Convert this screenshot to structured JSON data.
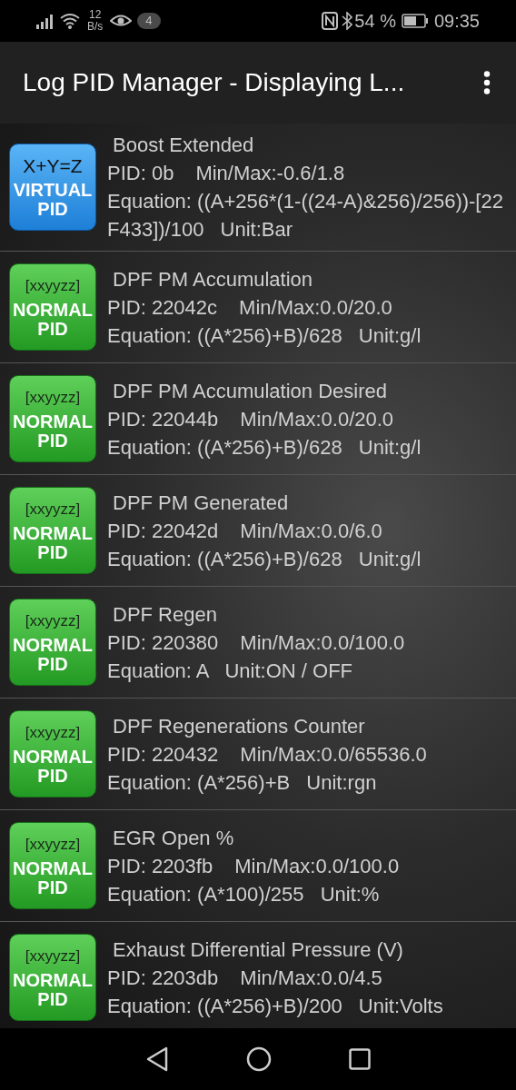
{
  "status_bar": {
    "net_speed_value": "12",
    "net_speed_unit": "B/s",
    "notification_count": "4",
    "battery": "54 %",
    "time": "09:35"
  },
  "app_bar": {
    "title": "Log PID Manager - Displaying L..."
  },
  "pids": [
    {
      "kind": "virtual",
      "badge": {
        "formula": "X+Y=Z",
        "line1": "VIRTUAL",
        "line2": "PID"
      },
      "name": "Boost Extended",
      "pid": "PID: 0b",
      "minmax": "Min/Max:-0.6/1.8",
      "equation": "Equation: ((A+256*(1-((24-A)&256)/256))-[22F433])/100",
      "unit": "Unit:Bar"
    },
    {
      "kind": "normal",
      "badge": {
        "formula": "[xxyyzz]",
        "line1": "NORMAL",
        "line2": "PID"
      },
      "name": "DPF PM Accumulation",
      "pid": "PID: 22042c",
      "minmax": "Min/Max:0.0/20.0",
      "equation": "Equation: ((A*256)+B)/628",
      "unit": "Unit:g/l"
    },
    {
      "kind": "normal",
      "badge": {
        "formula": "[xxyyzz]",
        "line1": "NORMAL",
        "line2": "PID"
      },
      "name": "DPF PM Accumulation Desired",
      "pid": "PID: 22044b",
      "minmax": "Min/Max:0.0/20.0",
      "equation": "Equation: ((A*256)+B)/628",
      "unit": "Unit:g/l"
    },
    {
      "kind": "normal",
      "badge": {
        "formula": "[xxyyzz]",
        "line1": "NORMAL",
        "line2": "PID"
      },
      "name": "DPF PM Generated",
      "pid": "PID: 22042d",
      "minmax": "Min/Max:0.0/6.0",
      "equation": "Equation: ((A*256)+B)/628",
      "unit": "Unit:g/l"
    },
    {
      "kind": "normal",
      "badge": {
        "formula": "[xxyyzz]",
        "line1": "NORMAL",
        "line2": "PID"
      },
      "name": "DPF Regen",
      "pid": "PID: 220380",
      "minmax": "Min/Max:0.0/100.0",
      "equation": "Equation: A",
      "unit": "Unit:ON / OFF"
    },
    {
      "kind": "normal",
      "badge": {
        "formula": "[xxyyzz]",
        "line1": "NORMAL",
        "line2": "PID"
      },
      "name": "DPF Regenerations Counter",
      "pid": "PID: 220432",
      "minmax": "Min/Max:0.0/65536.0",
      "equation": "Equation: (A*256)+B",
      "unit": "Unit:rgn"
    },
    {
      "kind": "normal",
      "badge": {
        "formula": "[xxyyzz]",
        "line1": "NORMAL",
        "line2": "PID"
      },
      "name": "EGR Open %",
      "pid": "PID: 2203fb",
      "minmax": "Min/Max:0.0/100.0",
      "equation": "Equation: (A*100)/255",
      "unit": "Unit:%"
    },
    {
      "kind": "normal",
      "badge": {
        "formula": "[xxyyzz]",
        "line1": "NORMAL",
        "line2": "PID"
      },
      "name": "Exhaust Differential Pressure (V)",
      "pid": "PID: 2203db",
      "minmax": "Min/Max:0.0/4.5",
      "equation": "Equation: ((A*256)+B)/200",
      "unit": "Unit:Volts"
    }
  ]
}
